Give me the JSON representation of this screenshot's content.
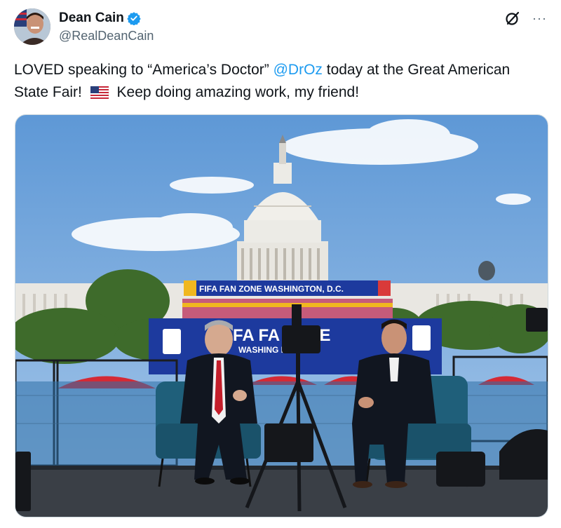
{
  "author": {
    "display_name": "Dean Cain",
    "handle": "@RealDeanCain",
    "verified": true,
    "avatar_icon": "profile-photo"
  },
  "actions": {
    "grok_icon": "grok-icon",
    "more_label": "···"
  },
  "tweet": {
    "part1": "LOVED speaking to “America’s Doctor” ",
    "mention": "@DrOz",
    "part2": " today at the Great American State Fair! ",
    "flag_icon": "us-flag-emoji",
    "part3": " Keep doing amazing work, my friend!"
  },
  "media": {
    "banner_text": "FIFA FAN ZONE  WASHINGTON, D.C.",
    "stage_sign_line1": "FA FA   ZONE",
    "stage_sign_line2": "WASHING     D.C.",
    "colors": {
      "sky": "#6fa5dc",
      "stage_sign": "#1d3a9e",
      "chairs": "#1f5f7a",
      "tie": "#c41e2a"
    }
  }
}
